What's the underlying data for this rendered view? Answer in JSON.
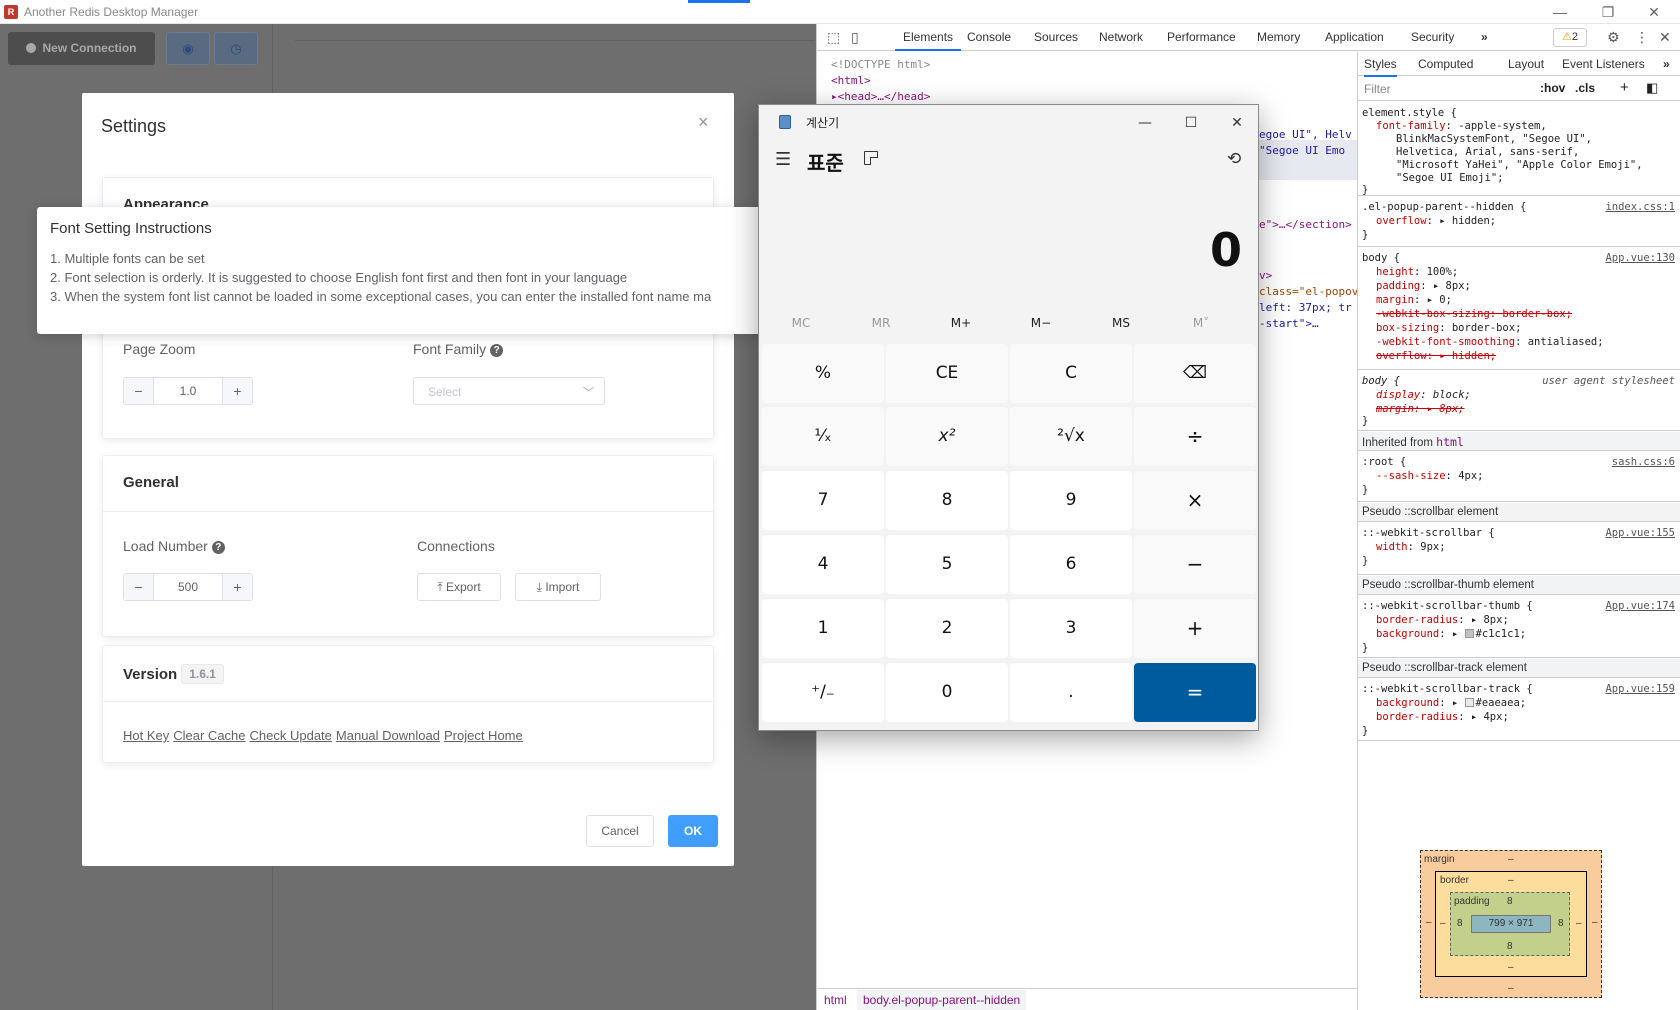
{
  "window": {
    "title": "Another Redis Desktop Manager",
    "logo": "R",
    "controls": {
      "minimize": "—",
      "maximize": "❐",
      "close": "✕"
    }
  },
  "sidebar": {
    "new_connection": "New Connection"
  },
  "settings": {
    "title": "Settings",
    "close": "×",
    "appearance": {
      "title": "Appearance",
      "page_zoom_label": "Page Zoom",
      "page_zoom_value": "1.0",
      "font_family_label": "Font Family",
      "font_family_placeholder": "Select"
    },
    "general": {
      "title": "General",
      "load_number_label": "Load Number",
      "load_number_value": "500",
      "connections_label": "Connections",
      "export": "Export",
      "import": "Import"
    },
    "version": {
      "title": "Version",
      "number": "1.6.1",
      "links": [
        "Hot Key",
        "Clear Cache",
        "Check Update",
        "Manual Download",
        "Project Home"
      ]
    },
    "cancel": "Cancel",
    "ok": "OK",
    "stepper_minus": "−",
    "stepper_plus": "+",
    "help": "?"
  },
  "font_tip": {
    "title": "Font Setting Instructions",
    "lines": [
      "1. Multiple fonts can be set",
      "2. Font selection is orderly. It is suggested to choose English font first and then font in your language",
      "3. When the system font list cannot be loaded in some exceptional cases, you can enter the installed font name ma"
    ]
  },
  "devtools": {
    "tabs": [
      "Elements",
      "Console",
      "Sources",
      "Network",
      "Performance",
      "Memory",
      "Application",
      "Security",
      "»"
    ],
    "warning_count": "2",
    "dom_lines": [
      "<!DOCTYPE html>",
      "<html>",
      "<head>…</head>"
    ],
    "dom_right": [
      "egoe UI\", Helv",
      "\"Segoe UI Emo",
      "e\">…</section>",
      "v>",
      "class=\"el-popov",
      "left: 37px; tr",
      "-start\">…"
    ],
    "breadcrumbs": [
      "html",
      "body.el-popup-parent--hidden"
    ],
    "styles_tabs": [
      "Styles",
      "Computed",
      "Layout",
      "Event Listeners",
      "»"
    ],
    "filter_placeholder": "Filter",
    "hov": ":hov",
    "cls": ".cls",
    "box_model": {
      "margin_label": "margin",
      "border_label": "border",
      "padding_label": "padding",
      "content": "799 × 971",
      "padding_value": "8",
      "dash": "–"
    }
  },
  "calculator": {
    "title": "계산기",
    "mode": "표준",
    "display": "0",
    "memory": [
      "MC",
      "MR",
      "M+",
      "M−",
      "MS",
      "M˅"
    ],
    "keys": [
      "%",
      "CE",
      "C",
      "⌫",
      "¹⁄ₓ",
      "x²",
      "²√x",
      "÷",
      "7",
      "8",
      "9",
      "×",
      "4",
      "5",
      "6",
      "−",
      "1",
      "2",
      "3",
      "+",
      "⁺∕₋",
      "0",
      ".",
      "="
    ]
  },
  "colors": {
    "accent": "#409eff",
    "calc_equals": "#005a9e",
    "overlay": "#6e6e6e"
  }
}
